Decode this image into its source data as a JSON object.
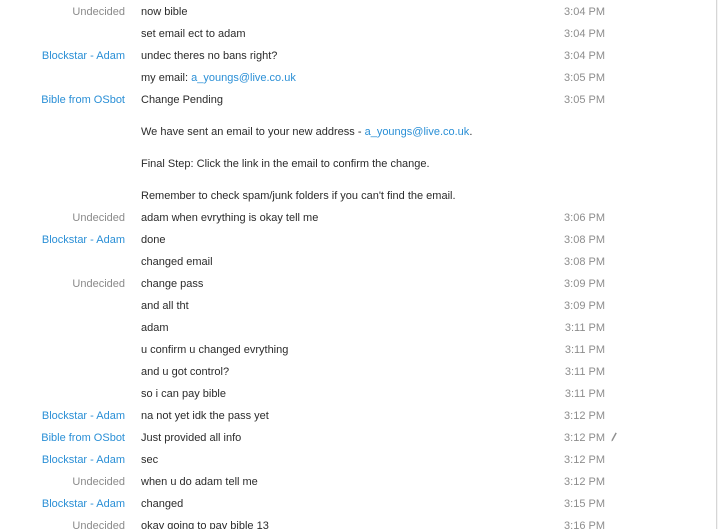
{
  "messages": [
    {
      "sender": "Undecided",
      "text": "now bible",
      "time": "3:04 PM"
    },
    {
      "sender": "",
      "text": "set email ect to adam",
      "time": "3:04 PM"
    },
    {
      "sender": "Blockstar - Adam",
      "text": "undec theres no bans right?",
      "time": "3:04 PM"
    },
    {
      "sender": "",
      "text_prefix": "my email: ",
      "link": "a_youngs@live.co.uk",
      "time": "3:05 PM"
    },
    {
      "sender": "Bible from OSbot",
      "text": "Change Pending",
      "time": "3:05 PM"
    },
    {
      "sender": "",
      "text_prefix": "We have sent an email to your new address - ",
      "link": "a_youngs@live.co.uk",
      "text_suffix": ".",
      "time": ""
    },
    {
      "sender": "",
      "text": "Final Step: Click the link in the email to confirm the change.",
      "time": ""
    },
    {
      "sender": "",
      "text": "Remember to check spam/junk folders if you can't find the email.",
      "time": ""
    },
    {
      "sender": "Undecided",
      "text": "adam when evrything is okay tell me",
      "time": "3:06 PM"
    },
    {
      "sender": "Blockstar - Adam",
      "text": "done",
      "time": "3:08 PM"
    },
    {
      "sender": "",
      "text": "changed email",
      "time": "3:08 PM"
    },
    {
      "sender": "Undecided",
      "text": "change pass",
      "time": "3:09 PM"
    },
    {
      "sender": "",
      "text": "and all tht",
      "time": "3:09 PM"
    },
    {
      "sender": "",
      "text": "adam",
      "time": "3:11 PM"
    },
    {
      "sender": "",
      "text": "u confirm u changed evrything",
      "time": "3:11 PM"
    },
    {
      "sender": "",
      "text": "and u got control?",
      "time": "3:11 PM"
    },
    {
      "sender": "",
      "text": "so i can pay bible",
      "time": "3:11 PM"
    },
    {
      "sender": "Blockstar - Adam",
      "text": "na not yet idk the pass yet",
      "time": "3:12 PM"
    },
    {
      "sender": "Bible from OSbot",
      "text": "Just provided all info",
      "time": "3:12 PM",
      "edited": true
    },
    {
      "sender": "Blockstar - Adam",
      "text": "sec",
      "time": "3:12 PM"
    },
    {
      "sender": "Undecided",
      "text": "when u do adam tell me",
      "time": "3:12 PM"
    },
    {
      "sender": "Blockstar - Adam",
      "text": "changed",
      "time": "3:15 PM"
    },
    {
      "sender": "Undecided",
      "text": "okay going to pay bible 13",
      "time": "3:16 PM"
    }
  ],
  "colors": {
    "sender_blue": "#2a8fd6",
    "sender_grey": "#8a8a8a",
    "time_grey": "#8d8d8d",
    "link": "#2a8fd6"
  },
  "icons": {
    "edited": "pencil-icon"
  }
}
